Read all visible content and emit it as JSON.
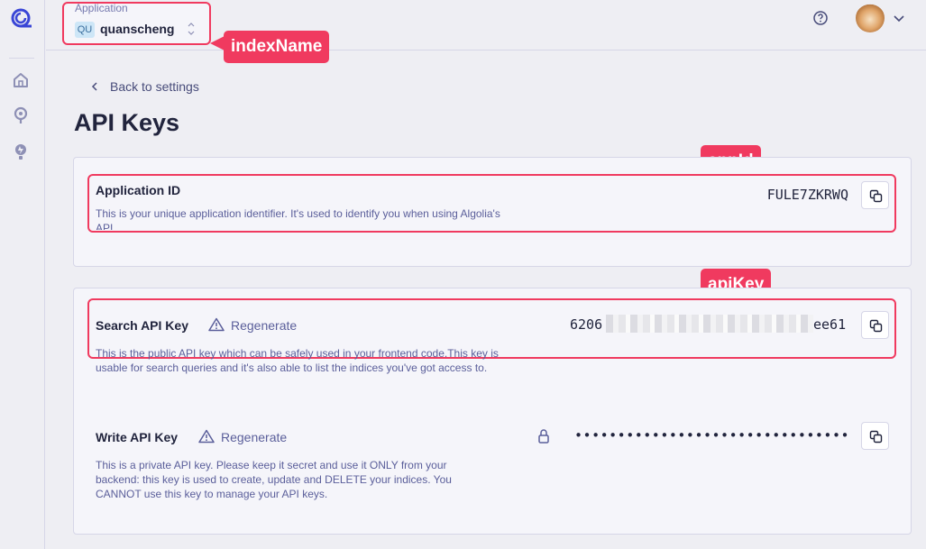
{
  "header": {
    "app_selector_label": "Application",
    "app_badge": "QU",
    "app_name": "quanscheng"
  },
  "callouts": {
    "index_name": "indexName",
    "app_id": "appId",
    "api_key": "apiKey"
  },
  "main": {
    "back_label": "Back to settings",
    "title": "API Keys"
  },
  "application_id": {
    "title": "Application ID",
    "description": "This is your unique application identifier. It's used to identify you when using Algolia's API.",
    "value": "FULE7ZKRWQ"
  },
  "search_key": {
    "title": "Search API Key",
    "regenerate_label": "Regenerate",
    "value_prefix": "6206",
    "value_suffix": "ee61",
    "description": "This is the public API key which can be safely used in your frontend code.This key is usable for search queries and it's also able to list the indices you've got access to."
  },
  "write_key": {
    "title": "Write API Key",
    "regenerate_label": "Regenerate",
    "masked_value": "••••••••••••••••••••••••••••••••",
    "description": "This is a private API key. Please keep it secret and use it ONLY from your backend: this key is used to create, update and DELETE your indices. You CANNOT use this key to manage your API keys."
  },
  "icons": {
    "logo": "algolia-logo-icon",
    "home": "home-icon",
    "search": "search-icon",
    "bulb": "lightbulb-icon",
    "help": "help-icon",
    "copy": "copy-icon",
    "warning": "warning-icon",
    "lock": "lock-icon"
  },
  "colors": {
    "accent": "#f03a5f",
    "primary": "#3a46d6",
    "text": "#21243d",
    "muted": "#5a5e9a"
  }
}
